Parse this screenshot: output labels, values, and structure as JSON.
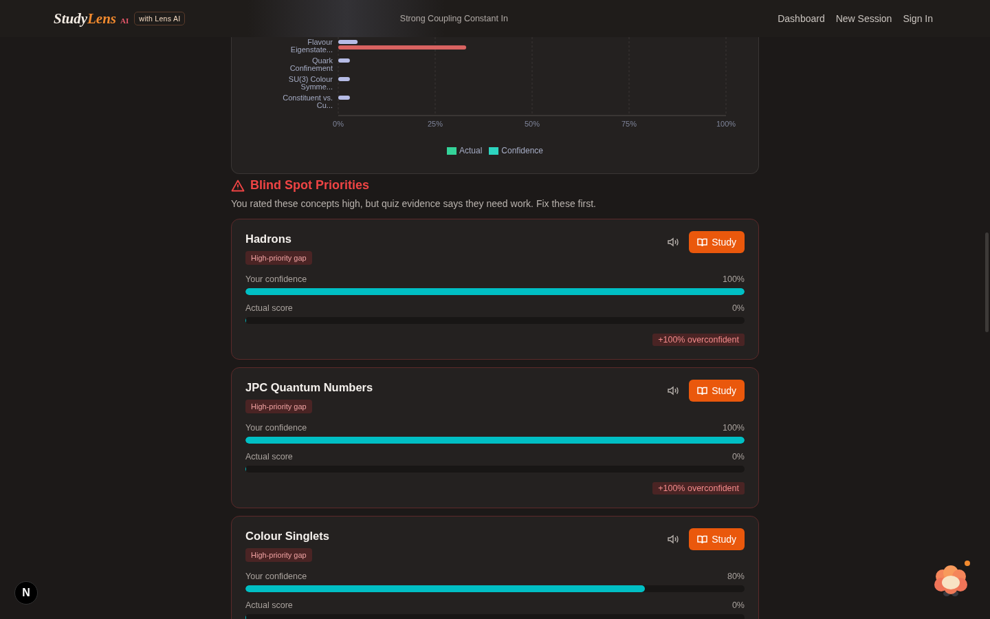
{
  "header": {
    "logo_primary": "Study",
    "logo_accent": "Lens",
    "logo_suffix": "AI",
    "badge": "with Lens AI",
    "title": "Strong Coupling Constant In",
    "nav": [
      {
        "label": "Dashboard"
      },
      {
        "label": "New Session"
      },
      {
        "label": "Sign In"
      }
    ]
  },
  "chart_panel": {
    "chart_data": {
      "type": "bar",
      "orientation": "horizontal",
      "grid": true,
      "categories": [
        "Flavour Eigenstate...",
        "Quark Confinement",
        "SU(3) Colour Symme...",
        "Constituent vs. Cu..."
      ],
      "xlim": [
        0,
        100
      ],
      "xticks": [
        {
          "value": 0,
          "label": "0%"
        },
        {
          "value": 25,
          "label": "25%"
        },
        {
          "value": 50,
          "label": "50%"
        },
        {
          "value": 75,
          "label": "75%"
        },
        {
          "value": 100,
          "label": "100%"
        }
      ],
      "series": [
        {
          "name": "Actual",
          "color": "#b6bce6",
          "values": [
            5,
            3,
            3,
            3
          ]
        },
        {
          "name": "Confidence",
          "color": "#d96361",
          "values": [
            33,
            null,
            null,
            null
          ]
        }
      ]
    },
    "legend_swatches": [
      {
        "color": "#34d399"
      },
      {
        "color": "#2dd4bf"
      }
    ]
  },
  "blind_spots": {
    "title": "Blind Spot Priorities",
    "subtitle": "You rated these concepts high, but quiz evidence says they need work. Fix these first.",
    "cards": [
      {
        "name": "Hadrons",
        "tag": "High-priority gap",
        "study_label": "Study",
        "confidence_label": "Your confidence",
        "confidence_value": "100%",
        "confidence": {
          "level": 1
        },
        "actual_label": "Actual score",
        "actual_value": "0%",
        "actual": {
          "level": 0
        },
        "gap": "+100% overconfident"
      },
      {
        "name": "JPC Quantum Numbers",
        "tag": "High-priority gap",
        "study_label": "Study",
        "confidence_label": "Your confidence",
        "confidence_value": "100%",
        "confidence": {
          "level": 1
        },
        "actual_label": "Actual score",
        "actual_value": "0%",
        "actual": {
          "level": 0
        },
        "gap": "+100% overconfident"
      },
      {
        "name": "Colour Singlets",
        "tag": "High-priority gap",
        "study_label": "Study",
        "confidence_label": "Your confidence",
        "confidence_value": "80%",
        "confidence": {
          "level": 0.8
        },
        "actual_label": "Actual score",
        "actual_value": "0%",
        "actual": {
          "level": 0
        }
      }
    ]
  },
  "dev_badge": {
    "label": "N"
  },
  "assistant": {
    "notification": true
  }
}
